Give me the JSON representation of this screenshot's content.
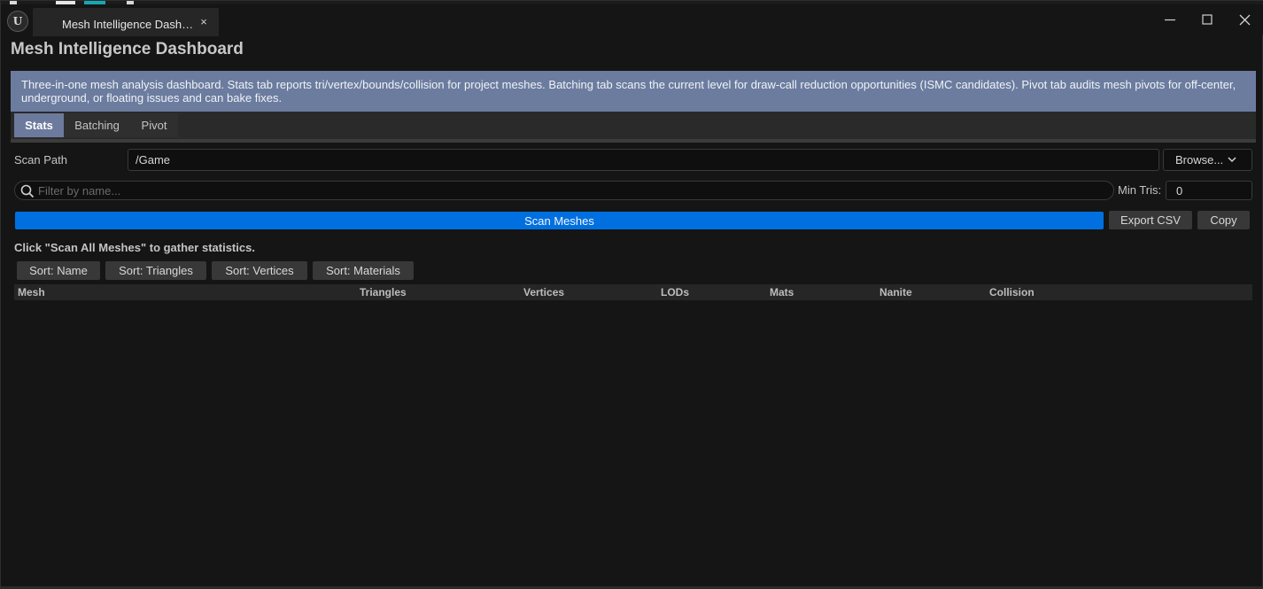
{
  "window": {
    "tab_title": "Mesh Intelligence Dash…",
    "tab_close_glyph": "×",
    "logo_glyph": "U",
    "controls": [
      "minimize-icon",
      "maximize-icon",
      "close-icon"
    ]
  },
  "panel": {
    "title": "Mesh Intelligence Dashboard",
    "info_banner": "Three-in-one mesh analysis dashboard. Stats tab reports tri/vertex/bounds/collision for project meshes. Batching tab scans the current level for draw-call reduction opportunities (ISMC candidates). Pivot tab audits mesh pivots for off-center, underground, or floating issues and can bake fixes.",
    "tabs": [
      {
        "label": "Stats",
        "active": true
      },
      {
        "label": "Batching",
        "active": false
      },
      {
        "label": "Pivot",
        "active": false
      }
    ]
  },
  "stats": {
    "scan_path_label": "Scan Path",
    "scan_path_value": "/Game",
    "browse_label": "Browse...",
    "search_placeholder": "Filter by name...",
    "min_tris_label": "Min Tris:",
    "min_tris_value": "0",
    "scan_button": "Scan Meshes",
    "export_csv_button": "Export CSV",
    "copy_button": "Copy",
    "status": "Click \"Scan All Meshes\" to gather statistics.",
    "sort_buttons": [
      "Sort: Name",
      "Sort: Triangles",
      "Sort: Vertices",
      "Sort: Materials"
    ],
    "columns": [
      "Mesh",
      "Triangles",
      "Vertices",
      "LODs",
      "Mats",
      "Nanite",
      "Collision"
    ]
  },
  "colors": {
    "background": "#151515",
    "banner": "#6b7c9f",
    "active_tab": "#6c7a9d",
    "primary_button": "#0070e0",
    "secondary_button": "#383838"
  }
}
